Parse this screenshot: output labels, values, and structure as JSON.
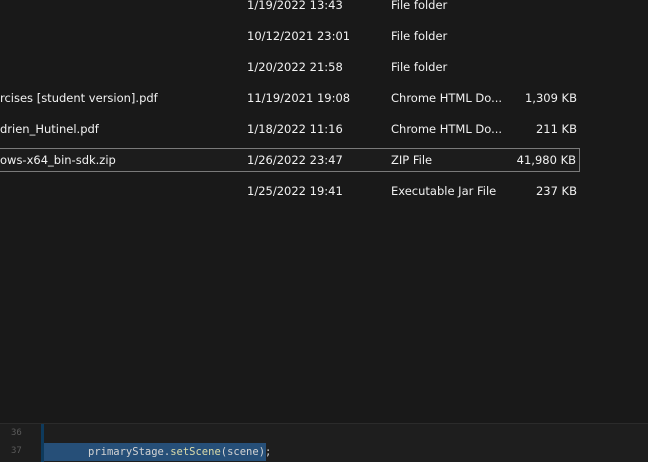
{
  "file_list": {
    "rows": [
      {
        "name": "",
        "date": "1/19/2022 13:43",
        "type": "File folder",
        "size": ""
      },
      {
        "name": "",
        "date": "10/12/2021 23:01",
        "type": "File folder",
        "size": ""
      },
      {
        "name": "",
        "date": "1/20/2022 21:58",
        "type": "File folder",
        "size": ""
      },
      {
        "name": "rcises [student version].pdf",
        "date": "11/19/2021 19:08",
        "type": "Chrome HTML Do...",
        "size": "1,309 KB"
      },
      {
        "name": "drien_Hutinel.pdf",
        "date": "1/18/2022 11:16",
        "type": "Chrome HTML Do...",
        "size": "211 KB"
      },
      {
        "name": "ows-x64_bin-sdk.zip",
        "date": "1/26/2022 23:47",
        "type": "ZIP File",
        "size": "41,980 KB"
      },
      {
        "name": "",
        "date": "1/25/2022 19:41",
        "type": "Executable Jar File",
        "size": "237 KB"
      }
    ]
  },
  "editor": {
    "line_numbers": [
      "36",
      "37"
    ],
    "code_line_37": {
      "object": "primaryStage",
      "dot": ".",
      "method": "setScene",
      "args": "(scene);"
    }
  }
}
